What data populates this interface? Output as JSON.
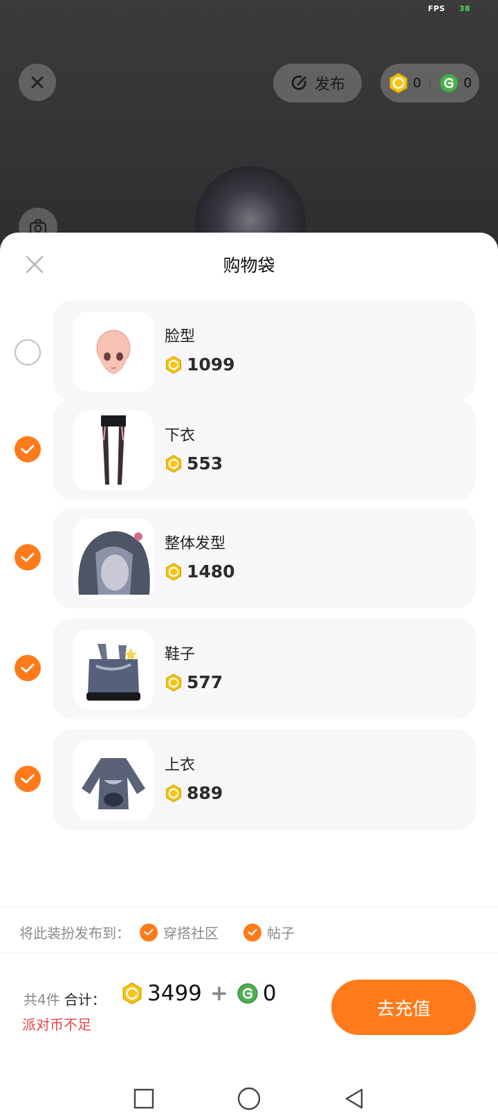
{
  "status": {
    "fps_label": "FPS",
    "fps_value": "38"
  },
  "top": {
    "publish_label": "发布",
    "coin_gold": "0",
    "coin_green": "0"
  },
  "sheet": {
    "title": "购物袋",
    "items": [
      {
        "name": "脸型",
        "price": "1099",
        "checked": false
      },
      {
        "name": "下衣",
        "price": "553",
        "checked": true
      },
      {
        "name": "整体发型",
        "price": "1480",
        "checked": true
      },
      {
        "name": "鞋子",
        "price": "577",
        "checked": true
      },
      {
        "name": "上衣",
        "price": "889",
        "checked": true
      }
    ],
    "publish_to_label": "将此装扮发布到：",
    "publish_options": [
      "穿搭社区",
      "帖子"
    ]
  },
  "footer": {
    "count_label": "共4件",
    "total_label": "合计：",
    "total_gold": "3499",
    "plus": "+",
    "total_green": "0",
    "warning": "派对币不足",
    "recharge_label": "去充值"
  },
  "colors": {
    "accent": "#ff7a1a",
    "warning": "#e64545",
    "gold_coin": "#f5c518",
    "green_coin": "#4caf50"
  }
}
